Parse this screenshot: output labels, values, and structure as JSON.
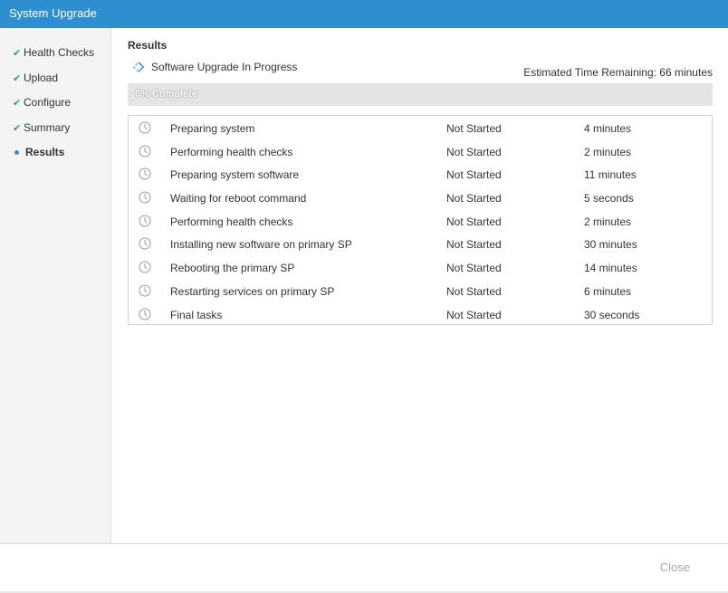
{
  "window": {
    "title": "System Upgrade"
  },
  "sidebar": {
    "steps": [
      {
        "label": "Health Checks",
        "state": "complete"
      },
      {
        "label": "Upload",
        "state": "complete"
      },
      {
        "label": "Configure",
        "state": "complete"
      },
      {
        "label": "Summary",
        "state": "complete"
      },
      {
        "label": "Results",
        "state": "current"
      }
    ]
  },
  "results": {
    "heading": "Results",
    "status_text": "Software Upgrade In Progress",
    "eta_text": "Estimated Time Remaining: 66 minutes",
    "progress": {
      "percent": 0,
      "label": "0% Complete"
    },
    "tasks": [
      {
        "name": "Preparing system",
        "status": "Not Started",
        "duration": "4 minutes"
      },
      {
        "name": "Performing health checks",
        "status": "Not Started",
        "duration": "2 minutes"
      },
      {
        "name": "Preparing system software",
        "status": "Not Started",
        "duration": "11 minutes"
      },
      {
        "name": "Waiting for reboot command",
        "status": "Not Started",
        "duration": "5 seconds"
      },
      {
        "name": "Performing health checks",
        "status": "Not Started",
        "duration": "2 minutes"
      },
      {
        "name": "Installing new software on primary SP",
        "status": "Not Started",
        "duration": "30 minutes"
      },
      {
        "name": "Rebooting the primary SP",
        "status": "Not Started",
        "duration": "14 minutes"
      },
      {
        "name": "Restarting services on primary SP",
        "status": "Not Started",
        "duration": "6 minutes"
      },
      {
        "name": "Final tasks",
        "status": "Not Started",
        "duration": "30 seconds"
      }
    ]
  },
  "footer": {
    "close_label": "Close"
  },
  "colors": {
    "accent": "#2e8fd0",
    "check": "#2ea84a",
    "disabled_text": "#a8a8a8"
  },
  "icons": {
    "complete_step": "check-icon",
    "current_step": "dot-icon",
    "task_pending": "clock-icon",
    "in_progress": "spinner-icon"
  }
}
